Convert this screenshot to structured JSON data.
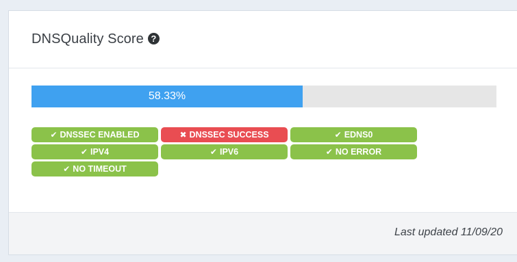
{
  "card": {
    "title": "DNSQuality Score",
    "help_icon": "question-circle-icon"
  },
  "progress": {
    "percent": 58.33,
    "label": "58.33%"
  },
  "colors": {
    "progress_fill": "#3fa1f0",
    "badge_ok": "#8bc24a",
    "badge_fail": "#e94d52"
  },
  "badges": [
    {
      "label": "DNSSEC ENABLED",
      "status": "ok",
      "icon": "check-icon"
    },
    {
      "label": "DNSSEC SUCCESS",
      "status": "fail",
      "icon": "x-icon"
    },
    {
      "label": "EDNS0",
      "status": "ok",
      "icon": "check-icon"
    },
    {
      "label": "IPV4",
      "status": "ok",
      "icon": "check-icon"
    },
    {
      "label": "IPV6",
      "status": "ok",
      "icon": "check-icon"
    },
    {
      "label": "NO ERROR",
      "status": "ok",
      "icon": "check-icon"
    },
    {
      "label": "NO TIMEOUT",
      "status": "ok",
      "icon": "check-icon"
    }
  ],
  "footer": {
    "last_updated": "Last updated 11/09/20"
  }
}
